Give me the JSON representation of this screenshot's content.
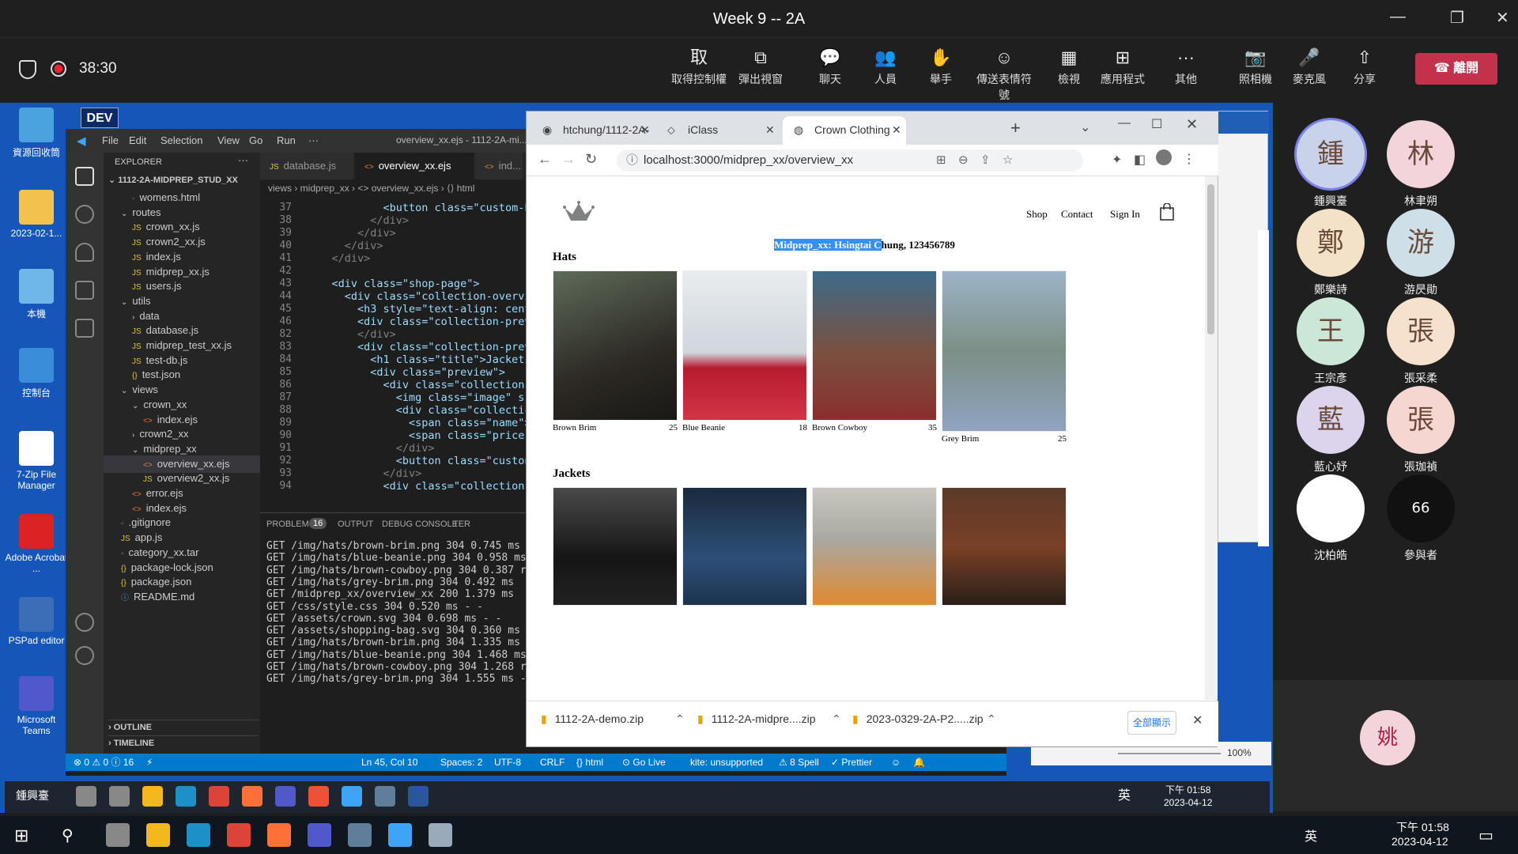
{
  "teams": {
    "title": "Week 9 -- 2A",
    "timer": "38:30",
    "toolbar": [
      {
        "icon": "取",
        "label": "取得控制權"
      },
      {
        "icon": "⧉",
        "label": "彈出視窗"
      },
      {
        "icon": "💬",
        "label": "聊天"
      },
      {
        "icon": "👥",
        "label": "人員"
      },
      {
        "icon": "✋",
        "label": "舉手"
      },
      {
        "icon": "☺",
        "label": "傳送表情符號"
      },
      {
        "icon": "▦",
        "label": "檢視"
      },
      {
        "icon": "⊞",
        "label": "應用程式"
      },
      {
        "icon": "···",
        "label": "其他"
      },
      {
        "icon": "📷",
        "label": "照相機"
      },
      {
        "icon": "🎤",
        "label": "麥克風"
      },
      {
        "icon": "⇧",
        "label": "分享"
      }
    ],
    "leave": "離開",
    "participants": [
      {
        "initial": "鍾",
        "name": "鍾興臺",
        "color": "#c8d2ea"
      },
      {
        "initial": "林",
        "name": "林聿朔",
        "color": "#f3d4da"
      },
      {
        "initial": "鄭",
        "name": "鄭樂詩",
        "color": "#f3e2c7"
      },
      {
        "initial": "游",
        "name": "游昃勛",
        "color": "#cfdfe8"
      },
      {
        "initial": "王",
        "name": "王宗彥",
        "color": "#cbe7d8"
      },
      {
        "initial": "張",
        "name": "張采柔",
        "color": "#f6e1cc"
      },
      {
        "initial": "藍",
        "name": "藍心妤",
        "color": "#dcd4ec"
      },
      {
        "initial": "張",
        "name": "張珈禎",
        "color": "#f5d6d0"
      },
      {
        "initial": "",
        "name": "沈柏皓",
        "color": "#ffffff"
      },
      {
        "initial": "66",
        "name": "參與者",
        "color": "#111111"
      }
    ],
    "presenter_initial": "姚"
  },
  "desktop": {
    "badge": "DEV",
    "icons": [
      "資源回收筒",
      "2023-02-1...",
      "本機",
      "控制台",
      "7-Zip File Manager",
      "Adobe Acrobat ...",
      "PSPad editor",
      "Microsoft Teams"
    ]
  },
  "vscode": {
    "menu": [
      "File",
      "Edit",
      "Selection",
      "View",
      "Go",
      "Run",
      "···"
    ],
    "window_title": "overview_xx.ejs - 1112-2A-mi...",
    "explorer_title": "EXPLORER",
    "project": "1112-2A-MIDPREP_STUD_XX",
    "tree": [
      {
        "t": "womens.html",
        "d": 2,
        "k": "file"
      },
      {
        "t": "routes",
        "d": 1,
        "k": "folder"
      },
      {
        "t": "crown_xx.js",
        "d": 2,
        "k": "js"
      },
      {
        "t": "crown2_xx.js",
        "d": 2,
        "k": "js"
      },
      {
        "t": "index.js",
        "d": 2,
        "k": "js"
      },
      {
        "t": "midprep_xx.js",
        "d": 2,
        "k": "js"
      },
      {
        "t": "users.js",
        "d": 2,
        "k": "js"
      },
      {
        "t": "utils",
        "d": 1,
        "k": "folder"
      },
      {
        "t": "data",
        "d": 2,
        "k": "folderc"
      },
      {
        "t": "database.js",
        "d": 2,
        "k": "js"
      },
      {
        "t": "midprep_test_xx.js",
        "d": 2,
        "k": "js"
      },
      {
        "t": "test-db.js",
        "d": 2,
        "k": "js"
      },
      {
        "t": "test.json",
        "d": 2,
        "k": "json"
      },
      {
        "t": "views",
        "d": 1,
        "k": "folder"
      },
      {
        "t": "crown_xx",
        "d": 2,
        "k": "folder"
      },
      {
        "t": "index.ejs",
        "d": 3,
        "k": "ejs"
      },
      {
        "t": "crown2_xx",
        "d": 2,
        "k": "folderc"
      },
      {
        "t": "midprep_xx",
        "d": 2,
        "k": "folder"
      },
      {
        "t": "overview_xx.ejs",
        "d": 3,
        "k": "ejs",
        "sel": true
      },
      {
        "t": "overview2_xx.js",
        "d": 3,
        "k": "js"
      },
      {
        "t": "error.ejs",
        "d": 2,
        "k": "ejs"
      },
      {
        "t": "index.ejs",
        "d": 2,
        "k": "ejs"
      },
      {
        "t": ".gitignore",
        "d": 1,
        "k": "file"
      },
      {
        "t": "app.js",
        "d": 1,
        "k": "js"
      },
      {
        "t": "category_xx.tar",
        "d": 1,
        "k": "file"
      },
      {
        "t": "package-lock.json",
        "d": 1,
        "k": "json"
      },
      {
        "t": "package.json",
        "d": 1,
        "k": "json"
      },
      {
        "t": "README.md",
        "d": 1,
        "k": "info"
      }
    ],
    "outline": "OUTLINE",
    "timeline": "TIMELINE",
    "tabs": [
      {
        "label": "database.js",
        "icon": "JS"
      },
      {
        "label": "overview_xx.ejs",
        "icon": "<>",
        "active": true
      },
      {
        "label": "ind...",
        "icon": "<>"
      }
    ],
    "breadcrumb": "views › midprep_xx › <> overview_xx.ejs › ⟨⟩ html",
    "lines": [
      {
        "n": "37",
        "c": "            <button class=\"custom-bu"
      },
      {
        "n": "38",
        "c": "          </div>"
      },
      {
        "n": "39",
        "c": "        </div>"
      },
      {
        "n": "40",
        "c": "      </div>"
      },
      {
        "n": "41",
        "c": "    </div>"
      },
      {
        "n": "42",
        "c": ""
      },
      {
        "n": "43",
        "c": "    <div class=\"shop-page\">"
      },
      {
        "n": "44",
        "c": "      <div class=\"collection-overvi"
      },
      {
        "n": "45",
        "c": "        <h3 style=\"text-align: cent"
      },
      {
        "n": "46",
        "c": "        <div class=\"collection-prev"
      },
      {
        "n": "82",
        "c": "        </div>"
      },
      {
        "n": "83",
        "c": "        <div class=\"collection-prev"
      },
      {
        "n": "84",
        "c": "          <h1 class=\"title\">Jackets"
      },
      {
        "n": "85",
        "c": "          <div class=\"preview\">"
      },
      {
        "n": "86",
        "c": "            <div class=\"collection-"
      },
      {
        "n": "87",
        "c": "              <img class=\"image\" sr"
      },
      {
        "n": "88",
        "c": "              <div class=\"collectic"
      },
      {
        "n": "89",
        "c": "                <span class=\"name\">"
      },
      {
        "n": "90",
        "c": "                <span class=\"price\""
      },
      {
        "n": "91",
        "c": "              </div>"
      },
      {
        "n": "92",
        "c": "              <button class=\"custon"
      },
      {
        "n": "93",
        "c": "            </div>"
      },
      {
        "n": "94",
        "c": "            <div class=\"collection-"
      }
    ],
    "panel_tabs": [
      "PROBLEMS",
      "OUTPUT",
      "DEBUG CONSOLE",
      "TER"
    ],
    "problems_count": "16",
    "log": [
      "GET /img/hats/brown-brim.png 304 0.745 ms",
      "GET /img/hats/blue-beanie.png 304 0.958 ms",
      "GET /img/hats/brown-cowboy.png 304 0.387 r",
      "GET /img/hats/grey-brim.png 304 0.492 ms",
      "GET /midprep_xx/overview_xx 200 1.379 ms",
      "GET /css/style.css 304 0.520 ms - -",
      "GET /assets/crown.svg 304 0.698 ms - -",
      "GET /assets/shopping-bag.svg 304 0.360 ms",
      "GET /img/hats/brown-brim.png 304 1.335 ms",
      "GET /img/hats/blue-beanie.png 304 1.468 ms",
      "GET /img/hats/brown-cowboy.png 304 1.268 r",
      "GET /img/hats/grey-brim.png 304 1.555 ms -"
    ],
    "status": {
      "errors": "⊗ 0 ⚠ 0 ⓘ 16",
      "position": "Ln 45, Col 10",
      "spaces": "Spaces: 2",
      "encoding": "UTF-8",
      "eol": "CRLF",
      "lang": "{} html",
      "golive": "⊙ Go Live",
      "kite": "kite: unsupported",
      "spell": "⚠ 8 Spell",
      "prettier": "✓ Prettier"
    }
  },
  "chrome": {
    "tabs": [
      "htchung/1112-2A-db",
      "iClass",
      "Crown Clothing"
    ],
    "url": "localhost:3000/midprep_xx/overview_xx",
    "nav_links": [
      "Shop",
      "Contact",
      "Sign In"
    ],
    "heading_selected": "Midprep_xx: Hsingtai C",
    "heading_rest": "hung, 123456789",
    "hats_title": "Hats",
    "hats": [
      {
        "name": "Brown Brim",
        "price": "25"
      },
      {
        "name": "Blue Beanie",
        "price": "18"
      },
      {
        "name": "Brown Cowboy",
        "price": "35"
      },
      {
        "name": "Grey Brim",
        "price": "25"
      }
    ],
    "jackets_title": "Jackets",
    "downloads": [
      "1112-2A-demo.zip",
      "1112-2A-midpre....zip",
      "2023-0329-2A-P2.....zip"
    ],
    "show_all": "全部顯示"
  },
  "inner_taskbar": {
    "user": "鍾興臺",
    "time": "下午 01:58",
    "date": "2023-04-12",
    "ime": "英",
    "zoom": "100%"
  },
  "outer_taskbar": {
    "time": "下午 01:58",
    "date": "2023-04-12",
    "ime": "英"
  }
}
